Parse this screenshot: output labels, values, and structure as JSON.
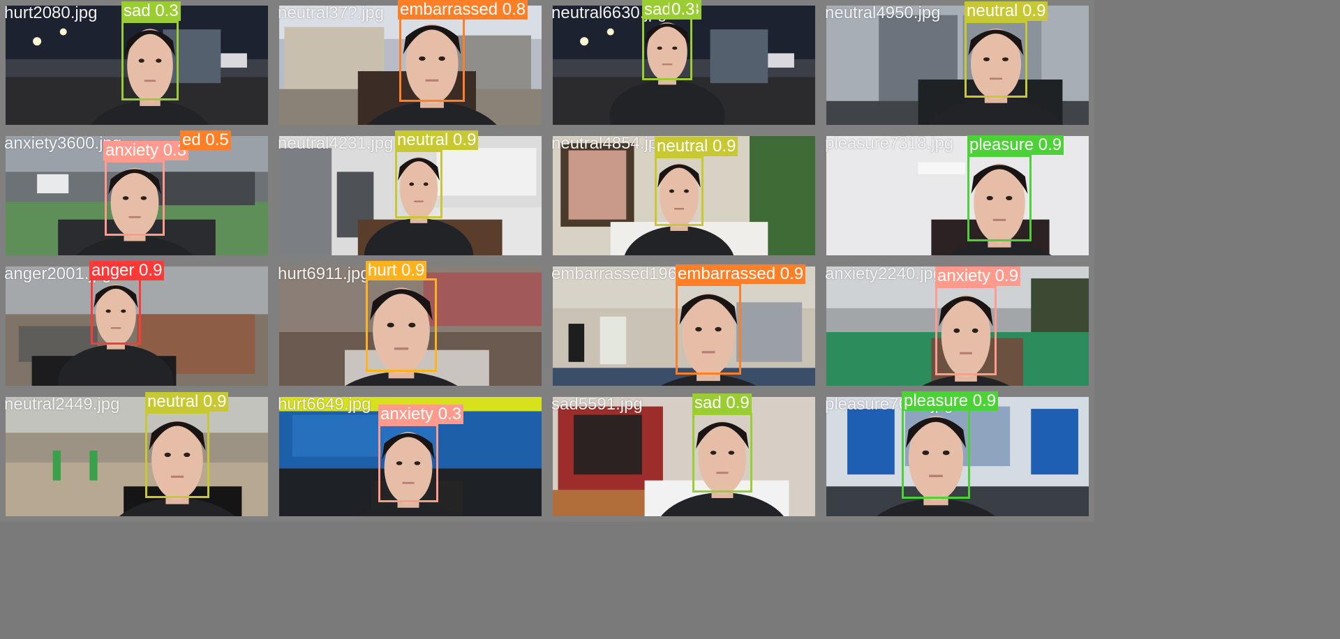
{
  "tiles": [
    {
      "file": "hurt2080.jpg",
      "scene": "street-night",
      "dets": [
        {
          "label": "sad 0.3",
          "color": "#9acd32"
        }
      ]
    },
    {
      "file": "neutral37?.jpg",
      "scene": "building-day",
      "dets": [
        {
          "label": "embarrassed 0.8",
          "color": "#ff7f27"
        }
      ]
    },
    {
      "file": "neutral6630.jpg",
      "scene": "street-night",
      "dets": [
        {
          "label": "sad 0.3",
          "color": "#9acd32"
        },
        {
          "label": "0.3",
          "color": "#9acd32"
        }
      ]
    },
    {
      "file": "neutral4950.jpg",
      "scene": "elevator",
      "dets": [
        {
          "label": "neutral 0.9",
          "color": "#c8c832"
        }
      ]
    },
    {
      "file": "anxiety3600.jpg",
      "scene": "parking",
      "dets": [
        {
          "label": "anxiety 0.3",
          "color": "#ff9a8c"
        },
        {
          "label": "ed 0.5",
          "color": "#ff7f27"
        }
      ]
    },
    {
      "file": "neutral4231.jpg",
      "scene": "kitchen",
      "dets": [
        {
          "label": "neutral 0.9",
          "color": "#c8c832"
        }
      ]
    },
    {
      "file": "neutral4854.jpg",
      "scene": "livingroom",
      "dets": [
        {
          "label": "neutral 0.9",
          "color": "#c8c832"
        }
      ]
    },
    {
      "file": "pleasure7318.jpg",
      "scene": "whitewall",
      "dets": [
        {
          "label": "pleasure 0.9",
          "color": "#4cd137"
        }
      ]
    },
    {
      "file": "anger2001.jpg",
      "scene": "park-stairs",
      "dets": [
        {
          "label": "anger 0.9",
          "color": "#ff3838"
        }
      ]
    },
    {
      "file": "hurt6911.jpg",
      "scene": "brickyard",
      "dets": [
        {
          "label": "hurt 0.9",
          "color": "#ffb21d"
        }
      ]
    },
    {
      "file": "embarrassed1966.jpg",
      "scene": "kitchen-sink",
      "dets": [
        {
          "label": "embarrassed 0.9",
          "color": "#ff7f27"
        }
      ]
    },
    {
      "file": "anxiety2240.jpg",
      "scene": "court",
      "dets": [
        {
          "label": "anxiety 0.9",
          "color": "#ff9a8c"
        }
      ]
    },
    {
      "file": "neutral2449.jpg",
      "scene": "playground",
      "dets": [
        {
          "label": "neutral 0.9",
          "color": "#c8c832"
        }
      ]
    },
    {
      "file": "hurt6649.jpg",
      "scene": "sign-blue",
      "dets": [
        {
          "label": "anxiety 0.3",
          "color": "#ff9a8c"
        }
      ]
    },
    {
      "file": "sad5591.jpg",
      "scene": "microwave",
      "dets": [
        {
          "label": "sad 0.9",
          "color": "#9acd32"
        }
      ]
    },
    {
      "file": "pleasure7647.jpg",
      "scene": "atm-blue",
      "dets": [
        {
          "label": "pleasure 0.9",
          "color": "#4cd137"
        }
      ]
    }
  ]
}
